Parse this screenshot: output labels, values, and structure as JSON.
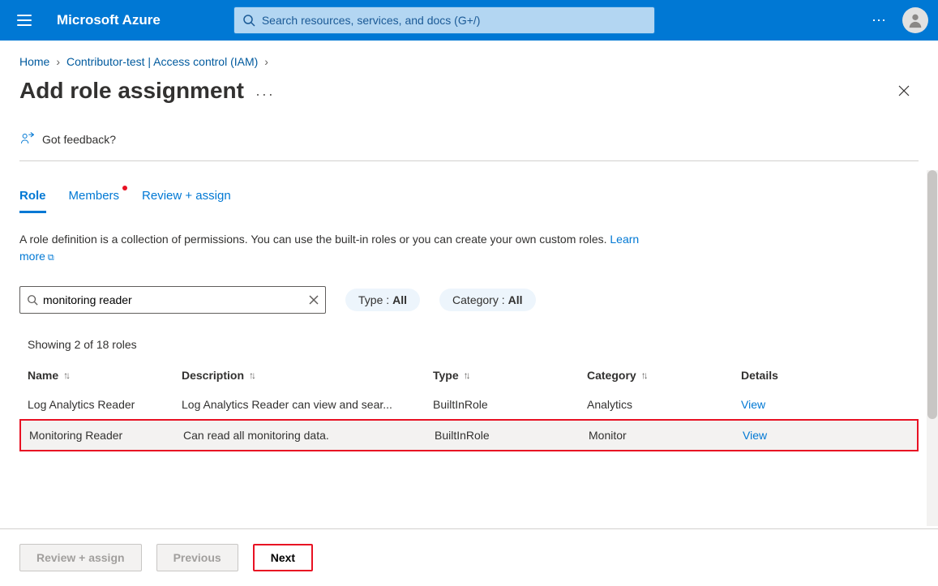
{
  "header": {
    "brand": "Microsoft Azure",
    "search_placeholder": "Search resources, services, and docs (G+/)"
  },
  "breadcrumb": {
    "home": "Home",
    "path1": "Contributor-test | Access control (IAM)"
  },
  "title": "Add role assignment",
  "feedback": "Got feedback?",
  "tabs": {
    "role": "Role",
    "members": "Members",
    "review": "Review + assign"
  },
  "intro": "A role definition is a collection of permissions. You can use the built-in roles or you can create your own custom roles. ",
  "learn_more": "Learn more",
  "role_search_value": "monitoring reader",
  "filter_type_label": "Type : ",
  "filter_type_value": "All",
  "filter_category_label": "Category : ",
  "filter_category_value": "All",
  "result_count": "Showing 2 of 18 roles",
  "columns": {
    "name": "Name",
    "description": "Description",
    "type": "Type",
    "category": "Category",
    "details": "Details"
  },
  "rows": [
    {
      "name": "Log Analytics Reader",
      "description": "Log Analytics Reader can view and sear...",
      "type": "BuiltInRole",
      "category": "Analytics",
      "details": "View"
    },
    {
      "name": "Monitoring Reader",
      "description": "Can read all monitoring data.",
      "type": "BuiltInRole",
      "category": "Monitor",
      "details": "View"
    }
  ],
  "buttons": {
    "review": "Review + assign",
    "previous": "Previous",
    "next": "Next"
  }
}
